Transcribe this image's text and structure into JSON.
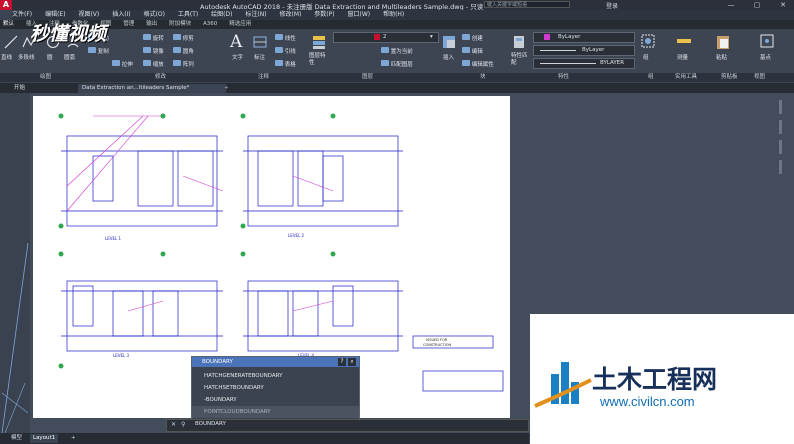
{
  "window": {
    "app_title": "Autodesk AutoCAD 2018 - 未注册版   Data Extraction and Multileaders Sample.dwg - 只读",
    "search_placeholder": "键入关键字或短语",
    "user_label": "登录"
  },
  "menubar": [
    "文件(F)",
    "编辑(E)",
    "视图(V)",
    "插入(I)",
    "格式(O)",
    "工具(T)",
    "绘图(D)",
    "标注(N)",
    "修改(M)",
    "参数(P)",
    "窗口(W)",
    "帮助(H)"
  ],
  "ribbon_tabs": [
    "默认",
    "插入",
    "注释",
    "参数化",
    "视图",
    "管理",
    "输出",
    "附加模块",
    "A360",
    "精选应用"
  ],
  "ribbon": {
    "draw_tools": [
      "直线",
      "多段线",
      "圆",
      "圆弧"
    ],
    "modify_tools": [
      "移动",
      "旋转",
      "修剪",
      "复制",
      "镜像",
      "圆角",
      "拉伸",
      "缩放",
      "阵列"
    ],
    "text_label": "文字",
    "dim_label": "标注",
    "annotation_tools": [
      "线性",
      "引线",
      "表格"
    ],
    "layer_label": "图层特性",
    "layer_value": "2",
    "layer_tools": [
      "置为当前",
      "匹配图层"
    ],
    "insert_label": "插入",
    "block_tools": [
      "创建",
      "编辑",
      "编辑属性"
    ],
    "match_label": "特性匹配",
    "bylayer_1": "ByLayer",
    "bylayer_2": "ByLayer",
    "bylayer_3": "BYLAYER",
    "group_label": "组",
    "measure_label": "测量",
    "paste_label": "粘贴",
    "base_label": "基点"
  },
  "panel_titles": [
    "绘图",
    "修改",
    "注释",
    "图层",
    "块",
    "特性",
    "组",
    "实用工具",
    "剪贴板",
    "视图"
  ],
  "doc_tabs": [
    "开始",
    "Data Extraction an...ltileaders Sample*"
  ],
  "autocomplete": {
    "header": "BOUNDARY",
    "items": [
      "HATCHGENERATEBOUNDARY",
      "HATCHSETBOUNDARY",
      "-BOUNDARY",
      "POINTCLOUDBOUNDARY"
    ]
  },
  "command_line": "BOUNDARY",
  "layout_tabs": [
    "模型",
    "Layout1"
  ],
  "drawing": {
    "level_labels": [
      "LEVEL 1",
      "LEVEL 2",
      "LEVEL 3",
      "LEVEL 4"
    ],
    "issued_for": "ISSUED FOR",
    "construction": "CONSTRUCTION"
  },
  "watermark": {
    "brand": "秒懂视频",
    "title": "土木工程网",
    "url": "www.civilcn.com"
  },
  "colors": {
    "accent_blue": "#4a73b8",
    "brand_red": "#c8102e",
    "line_blue": "#2a2ad0",
    "line_magenta": "#d03ad0"
  }
}
